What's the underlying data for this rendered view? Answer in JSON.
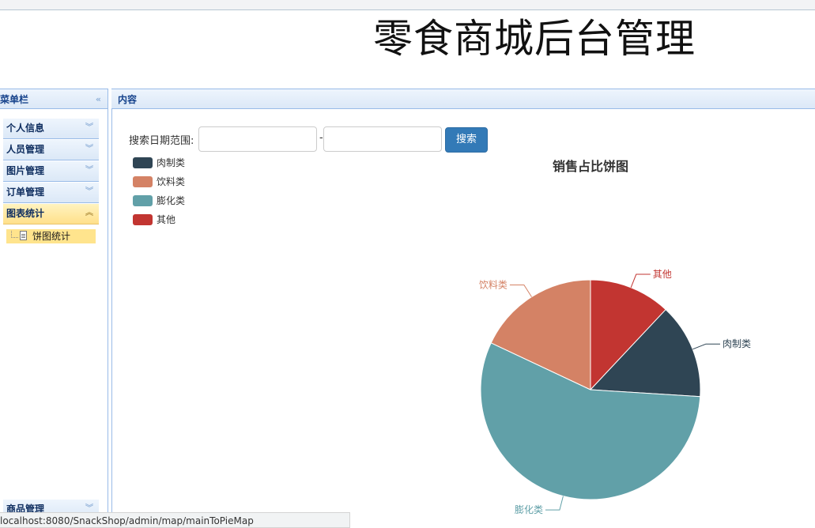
{
  "header": {
    "title": "零食商城后台管理"
  },
  "sidebar": {
    "title": "菜单栏",
    "items": [
      {
        "label": "个人信息"
      },
      {
        "label": "人员管理"
      },
      {
        "label": "图片管理"
      },
      {
        "label": "订单管理"
      },
      {
        "label": "图表统计",
        "active": true
      },
      {
        "label": "商品管理"
      }
    ],
    "sub_item": {
      "label": "饼图统计"
    }
  },
  "content": {
    "title": "内容",
    "search": {
      "label": "搜索日期范围:",
      "separator": "-",
      "start_value": "",
      "end_value": "",
      "button_label": "搜索"
    }
  },
  "status_bar": {
    "url": "localhost:8080/SnackShop/admin/map/mainToPieMap"
  },
  "chart_data": {
    "type": "pie",
    "title": "销售占比饼图",
    "legend_position": "top-left",
    "categories": [
      "肉制类",
      "饮料类",
      "膨化类",
      "其他"
    ],
    "values": [
      14,
      18,
      56,
      12
    ],
    "colors": [
      "#2f4554",
      "#d48265",
      "#61a0a8",
      "#c23531"
    ]
  }
}
